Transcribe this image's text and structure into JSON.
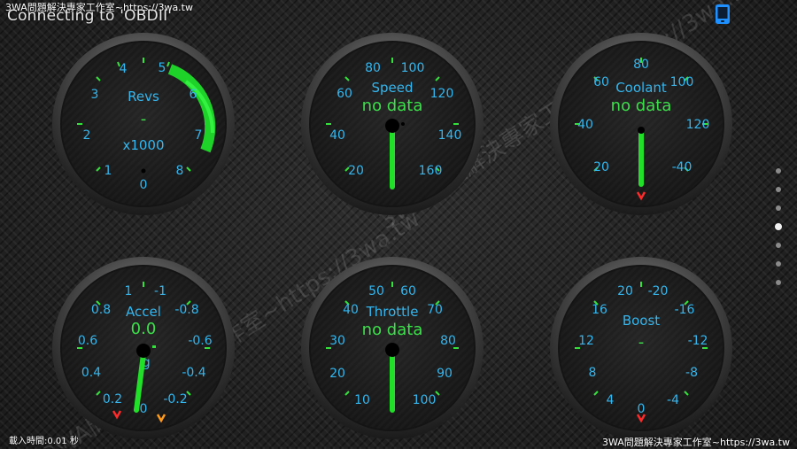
{
  "header": {
    "watermark": "3WA問題解決專家工作室~https://3wa.tw",
    "status": "Connecting to 'OBDII'"
  },
  "footer": {
    "load_time": "載入時間:0.01 秒",
    "watermark": "3WA問題解決專家工作室~https://3wa.tw"
  },
  "overlay_watermark": [
    "3WA問題解決專家工作室~https://3wa.tw",
    "3WA問題解決專家工作室~https://3wa.tw"
  ],
  "icons": {
    "connection": "phone-icon"
  },
  "pages": {
    "count": 7,
    "active": 3
  },
  "colors": {
    "label_blue": "#34b6ee",
    "value_green": "#3be04a",
    "needle_green": "#22e02a",
    "warning_red": "#ff2a2a",
    "warning_orange": "#ff9a1a"
  },
  "gauges": [
    {
      "id": "revs",
      "title": "Revs",
      "unit": "x1000",
      "value": "-",
      "labels": [
        "0",
        "1",
        "2",
        "3",
        "4",
        "5",
        "6",
        "7",
        "8"
      ],
      "needle": "dash",
      "redline_from": 5
    },
    {
      "id": "speed",
      "title": "Speed",
      "unit": "",
      "value": "no data",
      "labels": [
        "20",
        "40",
        "60",
        "80",
        "100",
        "120",
        "140",
        "160"
      ],
      "needle": "down"
    },
    {
      "id": "coolant",
      "title": "Coolant",
      "unit": "",
      "value": "no data",
      "labels": [
        "20",
        "40",
        "60",
        "80",
        "100",
        "120",
        "-40"
      ],
      "needle": "down",
      "warning": "red"
    },
    {
      "id": "accel",
      "title": "Accel",
      "unit": "g",
      "value": "0.0",
      "labels": [
        "0.2",
        "0.4",
        "0.6",
        "0.8",
        "1",
        "-1",
        "-0.8",
        "-0.6",
        "-0.4",
        "-0.2",
        "0"
      ],
      "needle": "angled",
      "warning": "red+orange"
    },
    {
      "id": "throttle",
      "title": "Throttle",
      "unit": "",
      "value": "no data",
      "labels": [
        "10",
        "20",
        "30",
        "40",
        "50",
        "60",
        "70",
        "80",
        "90",
        "100"
      ],
      "needle": "down"
    },
    {
      "id": "boost",
      "title": "Boost",
      "unit": "",
      "value": "-",
      "labels": [
        "4",
        "8",
        "12",
        "16",
        "20",
        "-20",
        "-16",
        "-12",
        "-8",
        "-4",
        "0"
      ],
      "needle": "none",
      "warning": "red"
    }
  ]
}
